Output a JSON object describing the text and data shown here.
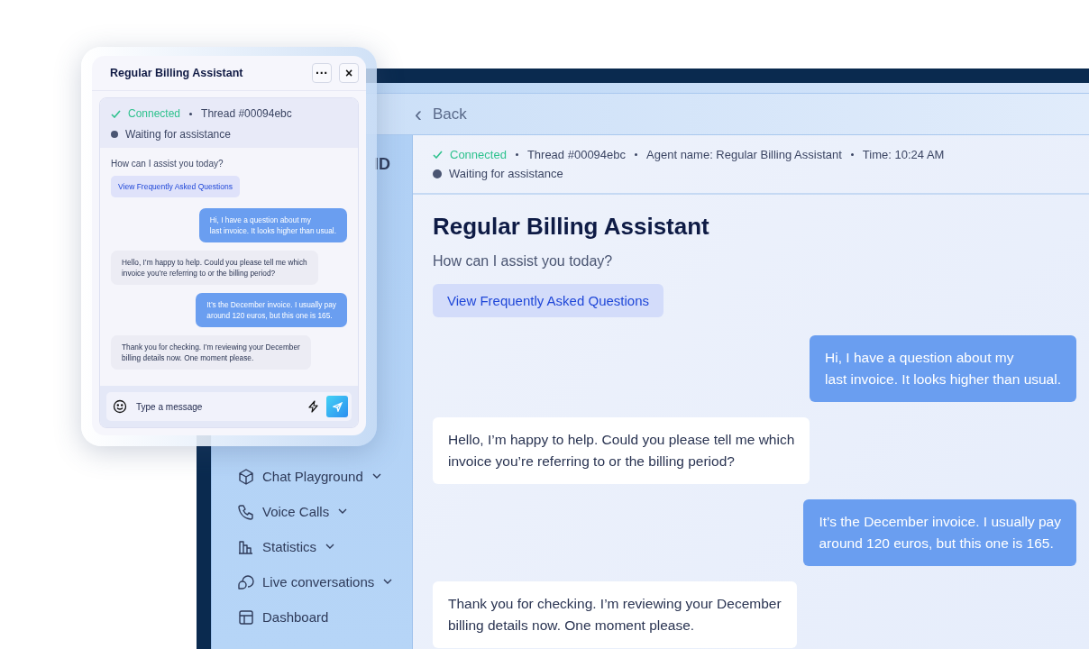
{
  "app": {
    "back": {
      "icon": "‹",
      "label": "Back"
    },
    "sidebar": {
      "logo": "ID",
      "items": [
        {
          "label": "Chat Playground",
          "has_submenu": true
        },
        {
          "label": "Voice Calls",
          "has_submenu": true
        },
        {
          "label": "Statistics",
          "has_submenu": true
        },
        {
          "label": "Live conversations",
          "has_submenu": true
        },
        {
          "label": "Dashboard",
          "has_submenu": false
        }
      ]
    },
    "status": {
      "connected": "Connected",
      "details": [
        "Thread #00094ebc",
        "Agent name: Regular Billing Assistant",
        "Time: 10:24 AM"
      ],
      "waiting": "Waiting for assistance"
    },
    "title": "Regular Billing Assistant",
    "greeting": "How can I assist you today?",
    "faq_button": "View Frequently Asked Questions",
    "messages": [
      {
        "kind": "user",
        "text": "Hi, I have a question about my\nlast invoice. It looks higher than usual."
      },
      {
        "kind": "agent",
        "text": "Hello, I’m happy to help. Could you please tell me which\ninvoice you’re referring to or the billing period?"
      },
      {
        "kind": "user",
        "text": "It’s the December invoice. I usually pay\naround 120 euros, but this one is 165."
      },
      {
        "kind": "agent",
        "text": "Thank you for checking. I’m reviewing your December\nbilling details now. One moment please."
      }
    ]
  },
  "widget": {
    "title": "Regular Billing Assistant",
    "more_button": "···",
    "close_button": "×",
    "status": {
      "connected": "Connected",
      "details": [
        "Thread #00094ebc"
      ],
      "waiting": "Waiting for assistance"
    },
    "greeting": "How can I assist you today?",
    "faq_button": "View Frequently Asked Questions",
    "messages": [
      {
        "kind": "user",
        "text": "Hi, I have a question about my\nlast invoice. It looks higher than usual."
      },
      {
        "kind": "agent",
        "text": "Hello, I’m happy to help. Could you please tell me which\ninvoice you’re referring to or the billing period?"
      },
      {
        "kind": "user",
        "text": "It’s the December invoice. I usually pay\naround 120 euros, but this one is 165."
      },
      {
        "kind": "agent",
        "text": "Thank you for checking. I’m reviewing your December\nbilling details now. One moment please."
      }
    ],
    "input": {
      "placeholder": "Type a message"
    }
  }
}
